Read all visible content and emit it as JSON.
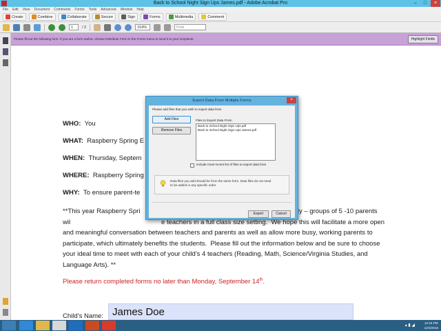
{
  "window": {
    "title": "Back to School Night Sign Ups James.pdf - Adobe Acrobat Pro",
    "minimize": "–",
    "maximize": "□",
    "close": "×"
  },
  "menu": [
    "File",
    "Edit",
    "View",
    "Document",
    "Comments",
    "Forms",
    "Tools",
    "Advanced",
    "Window",
    "Help"
  ],
  "toolbar1": {
    "create": "Create",
    "combine": "Combine",
    "collaborate": "Collaborate",
    "secure": "Secure",
    "sign": "Sign",
    "forms": "Forms",
    "multimedia": "Multimedia",
    "comment": "Comment"
  },
  "toolbar2": {
    "page_current": "1",
    "page_total": "/ 2",
    "zoom": "164%",
    "find_placeholder": "Find"
  },
  "form_notice": {
    "text": "Please fill out the following form. If you are a form author, choose Distribute Form in the Forms menu to send it to your recipients.",
    "highlight_button": "Highlight Fields"
  },
  "document": {
    "who_label": "WHO:",
    "who_value": "You",
    "what_label": "WHAT:",
    "what_value": "Raspberry Spring E",
    "when_label": "WHEN:",
    "when_value": "Thursday, Septem",
    "where_label": "WHERE:",
    "where_value": "Raspberry Spring",
    "why_label": "WHY:",
    "why_value": "To ensure parent-te",
    "paragraph": "**This year Raspberry Spri                                                    l Night a little differently – groups of 5 -10 parents wil                                                  e teachers in a full class size setting.  We hope this will facilitate a more open and meaningful conversation between teachers and parents as well as allow more busy, working parents to participate, which ultimately benefits the students.  Please fill out the information below and be sure to choose your ideal time to meet with each of your child’s 4 teachers (Reading, Math, Science/Virginia Studies, and Language Arts). **",
    "return_notice": "Please return completed forms no later than Monday, September 14",
    "return_notice_sup": "th",
    "return_notice_end": ".",
    "child_name_label": "Child’s Name:",
    "child_name_value": "James Doe"
  },
  "dialog": {
    "title": "Export Data From Multiple Forms",
    "close": "×",
    "instruction": "Please add files that you wish to export data from",
    "add_files": "Add Files",
    "remove_files": "Remove Files",
    "files_label": "Files to Export Data From:",
    "files": [
      "Back to School Night Sign Ups.pdf",
      "Back to School Night Sign Ups James.pdf"
    ],
    "checkbox_label": "Include most recent list of files to export data from",
    "checkbox_checked": false,
    "info_text": "Data files you add should be from the same form. Data files do not need to be added in any specific order.",
    "export": "Export",
    "cancel": "Cancel"
  },
  "taskbar": {
    "time": "12:16 PM",
    "date": "12/4/2015"
  },
  "colors": {
    "titlebar": "#5ec1e6",
    "notice_bar": "#c9a1d9",
    "dialog_frame": "#64b2de",
    "taskbar": "#2b5e83",
    "name_field": "#dbe3fa",
    "red_text": "#d02121"
  }
}
